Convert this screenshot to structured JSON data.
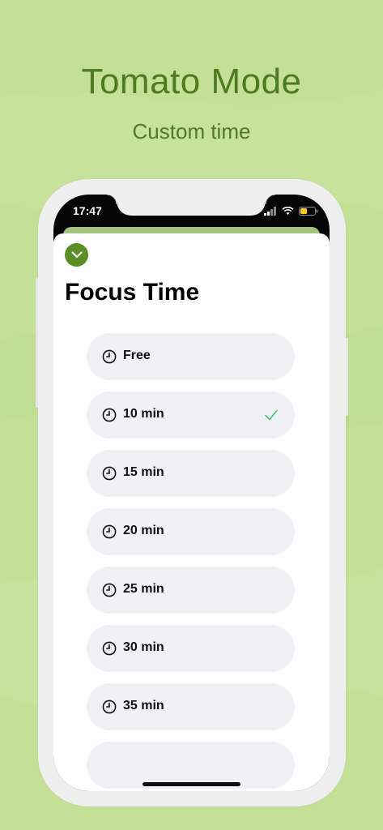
{
  "colors": {
    "background": "#c3e096",
    "accent_green": "#4e7a21",
    "button_green": "#5b8f25",
    "check_green": "#34c759"
  },
  "promo": {
    "title": "Tomato Mode",
    "subtitle": "Custom time"
  },
  "status_bar": {
    "time": "17:47",
    "icons": [
      "signal-icon",
      "wifi-icon",
      "battery-icon"
    ]
  },
  "sheet": {
    "collapse_icon": "chevron-down-icon",
    "title": "Focus Time",
    "options": [
      {
        "label": "Free",
        "selected": false
      },
      {
        "label": "10 min",
        "selected": true
      },
      {
        "label": "15 min",
        "selected": false
      },
      {
        "label": "20 min",
        "selected": false
      },
      {
        "label": "25 min",
        "selected": false
      },
      {
        "label": "30 min",
        "selected": false
      },
      {
        "label": "35 min",
        "selected": false
      }
    ]
  }
}
